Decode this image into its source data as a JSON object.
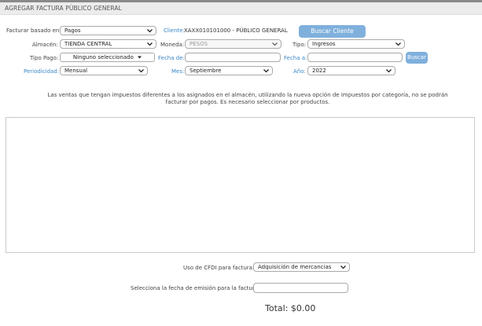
{
  "header": {
    "title": "AGREGAR FACTURA PÚBLICO GENERAL"
  },
  "form": {
    "facturar_basado_label": "Facturar basado en:",
    "facturar_basado_value": "Pagos",
    "cliente_label": "Cliente:",
    "cliente_value": "XAXX010101000 - PÚBLICO GENERAL",
    "buscar_cliente_button": "Buscar Cliente",
    "almacen_label": "Almacén:",
    "almacen_value": "TIENDA CENTRAL",
    "moneda_label": "Moneda:",
    "moneda_value": "PESOS",
    "tipo_label": "Tipo:",
    "tipo_value": "Ingresos",
    "tipo_pago_label": "Tipo Pago:",
    "tipo_pago_value": "Ninguno seleccionado",
    "fecha_de_label": "Fecha de:",
    "fecha_de_value": "",
    "fecha_a_label": "Fecha a:",
    "fecha_a_value": "",
    "buscar_button": "Buscar",
    "periodicidad_label": "Periodicidad:",
    "periodicidad_value": "Mensual",
    "mes_label": "Mes:",
    "mes_value": "Septiembre",
    "anio_label": "Año:",
    "anio_value": "2022"
  },
  "notice": "Las ventas que tengan impuestos diferentes a los asignados en el almacén, utilizando la nueva opción de impuestos por categoría, no se podrán facturar por pagos. Es necesario seleccionar por productos.",
  "footer": {
    "uso_cfdi_label": "Uso de CFDI para factura:",
    "uso_cfdi_value": "Adquisición de mercancias",
    "fecha_emision_label": "Selecciona la fecha de emisión para la factura:",
    "fecha_emision_value": "",
    "total_text": "Total: $0.00"
  },
  "colors": {
    "accent": "#7fb0dc",
    "link_label": "#3b87c8",
    "titlebar": "#ececec"
  },
  "icons": {
    "select_arrow": "chevron-down-icon",
    "multiselect_arrow": "caret-down-icon"
  }
}
